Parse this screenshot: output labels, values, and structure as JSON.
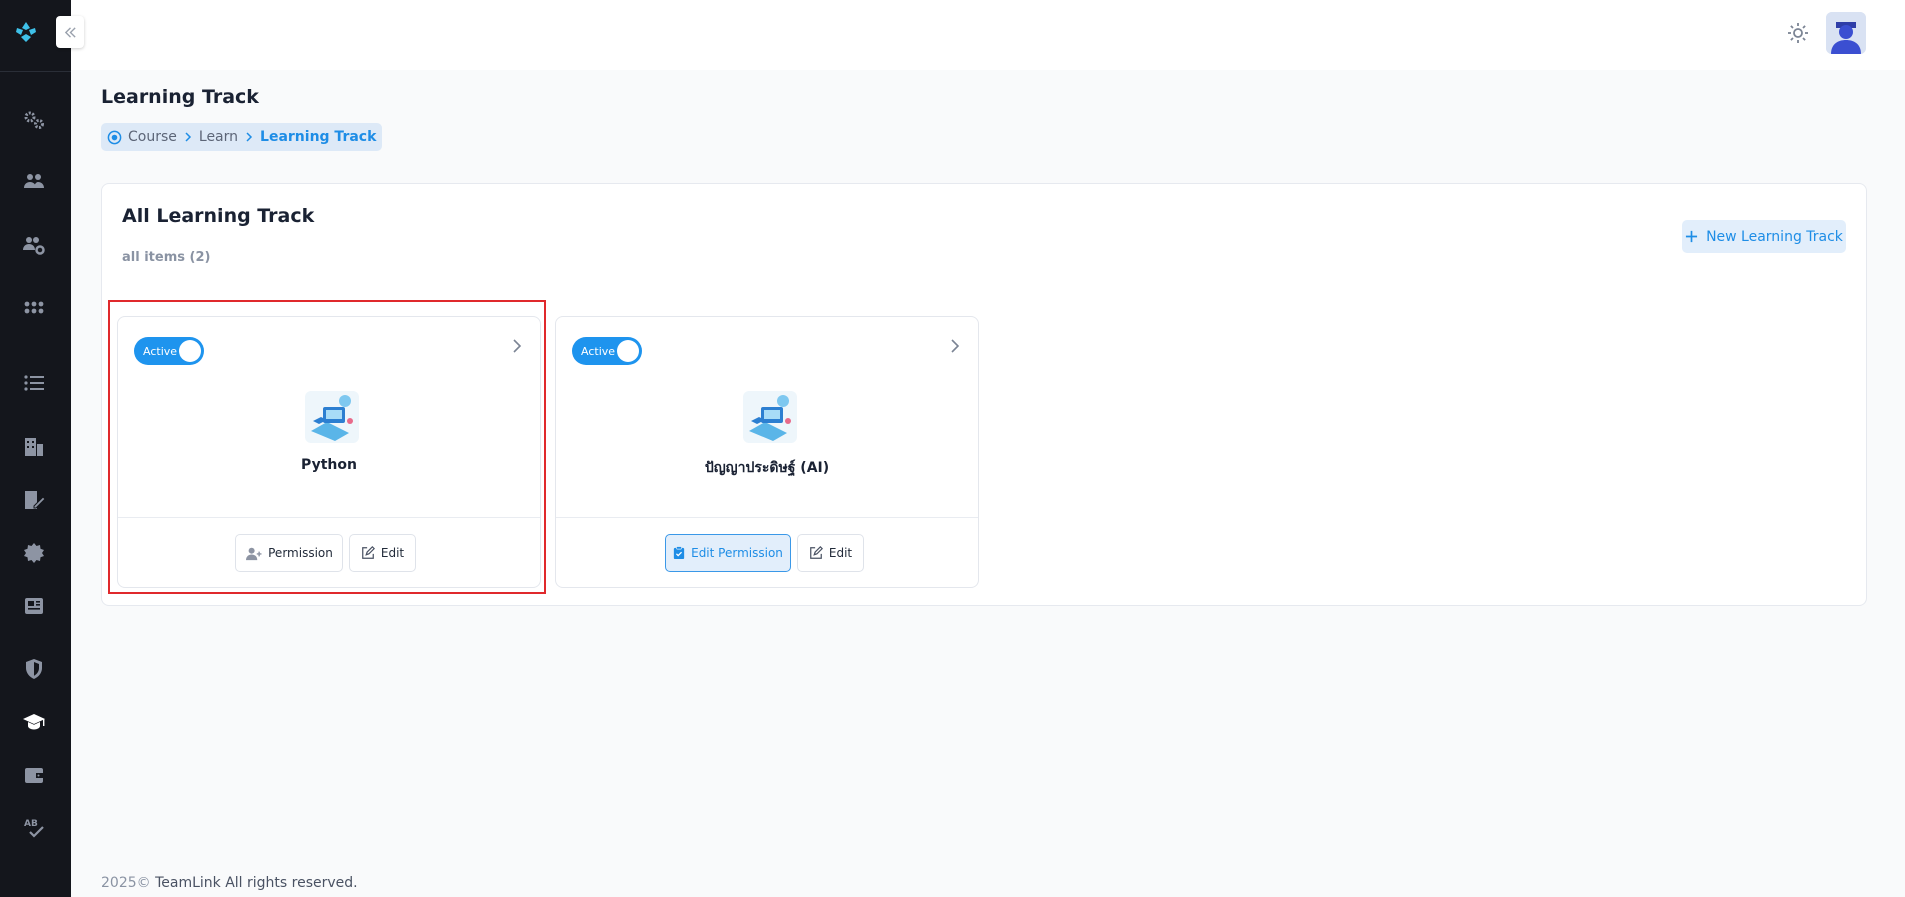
{
  "app": {
    "brand": "TeamLink"
  },
  "header": {
    "theme_icon": "sun-icon",
    "avatar": "user-avatar"
  },
  "page": {
    "title": "Learning Track",
    "breadcrumb": [
      "Course",
      "Learn",
      "Learning Track"
    ]
  },
  "panel": {
    "title": "All Learning Track",
    "subtitle": "all items (2)",
    "new_button": "New Learning Track"
  },
  "cards": [
    {
      "status": "Active",
      "name": "Python",
      "btn1": "Permission",
      "btn2": "Edit"
    },
    {
      "status": "Active",
      "name": "ปัญญาประดิษฐ์ (AI)",
      "btn1": "Edit Permission",
      "btn2": "Edit"
    }
  ],
  "footer": {
    "year": "2025©",
    "text": "TeamLink All rights reserved."
  },
  "colors": {
    "accent": "#1e94ee",
    "sidebar": "#14161c",
    "highlight": "#e0292c"
  }
}
